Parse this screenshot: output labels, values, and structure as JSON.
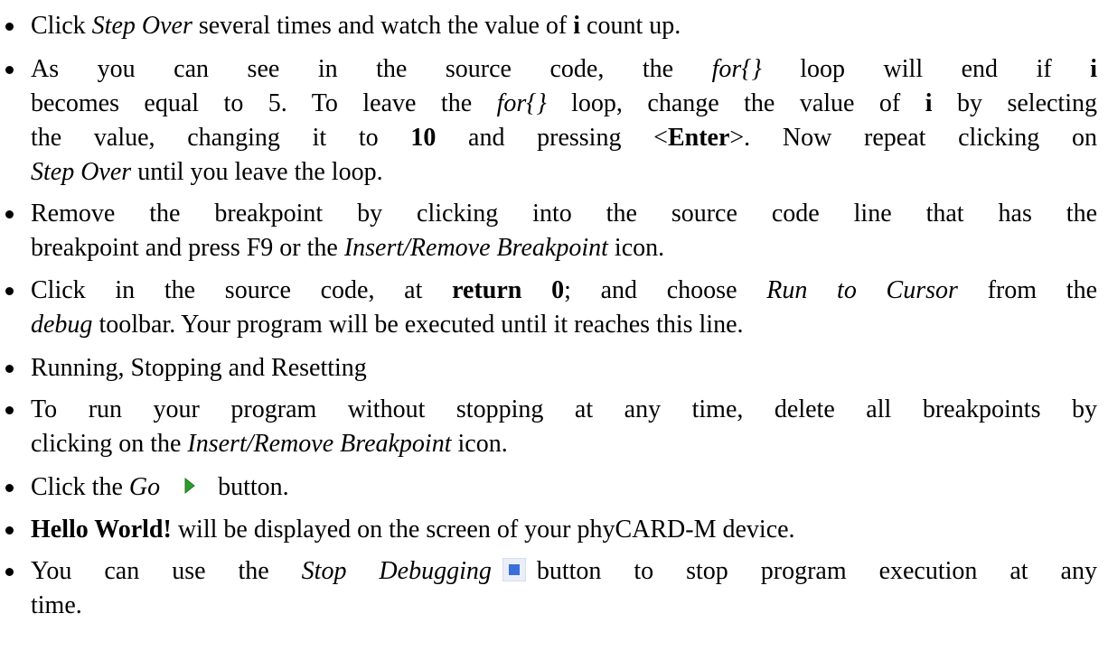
{
  "bullets": [
    {
      "parts": [
        "Click ",
        "Step Over",
        " several times and watch the value of ",
        "i",
        " count up."
      ]
    },
    {
      "lines": [
        [
          "As you can see in the source code, the ",
          "for{}",
          " loop will end if ",
          "i"
        ],
        [
          "becomes equal to 5. To leave the ",
          "for{}",
          " loop, change the value of ",
          "i",
          " by selecting"
        ],
        [
          "the value, changing it to ",
          "10",
          " and pressing <",
          "Enter",
          ">. Now repeat clicking on"
        ],
        [
          "Step Over",
          " until you leave the loop."
        ]
      ]
    },
    {
      "lines": [
        [
          "Remove the breakpoint by clicking into the source code line that has the"
        ],
        [
          "breakpoint and press F9 or the ",
          "Insert/Remove Breakpoint",
          " icon."
        ]
      ]
    },
    {
      "lines": [
        [
          "Click in the source code, at ",
          "return 0",
          "; and choose ",
          "Run to Cursor",
          " from the"
        ],
        [
          "debug",
          " toolbar. Your program will be executed until it reaches this line."
        ]
      ]
    },
    {
      "parts": [
        "Running, Stopping and Resetting"
      ]
    },
    {
      "lines": [
        [
          "To run your program without stopping at any time, delete all breakpoints by"
        ],
        [
          "clicking on the ",
          "Insert/Remove Breakpoint",
          " icon."
        ]
      ]
    },
    {
      "parts": [
        "Click the ",
        "Go",
        "button."
      ]
    },
    {
      "parts": [
        "Hello World!",
        " will be displayed on the screen of your phyCARD-M device."
      ]
    },
    {
      "lines": [
        [
          "You can use the ",
          "Stop Debugging",
          "button to stop program execution at any"
        ],
        [
          "time."
        ]
      ]
    }
  ],
  "icons": {
    "go": "go-play-icon",
    "stop": "stop-debugging-icon"
  },
  "colors": {
    "go_icon": "#2e9b2e",
    "stop_icon": "#3a6fd8"
  }
}
